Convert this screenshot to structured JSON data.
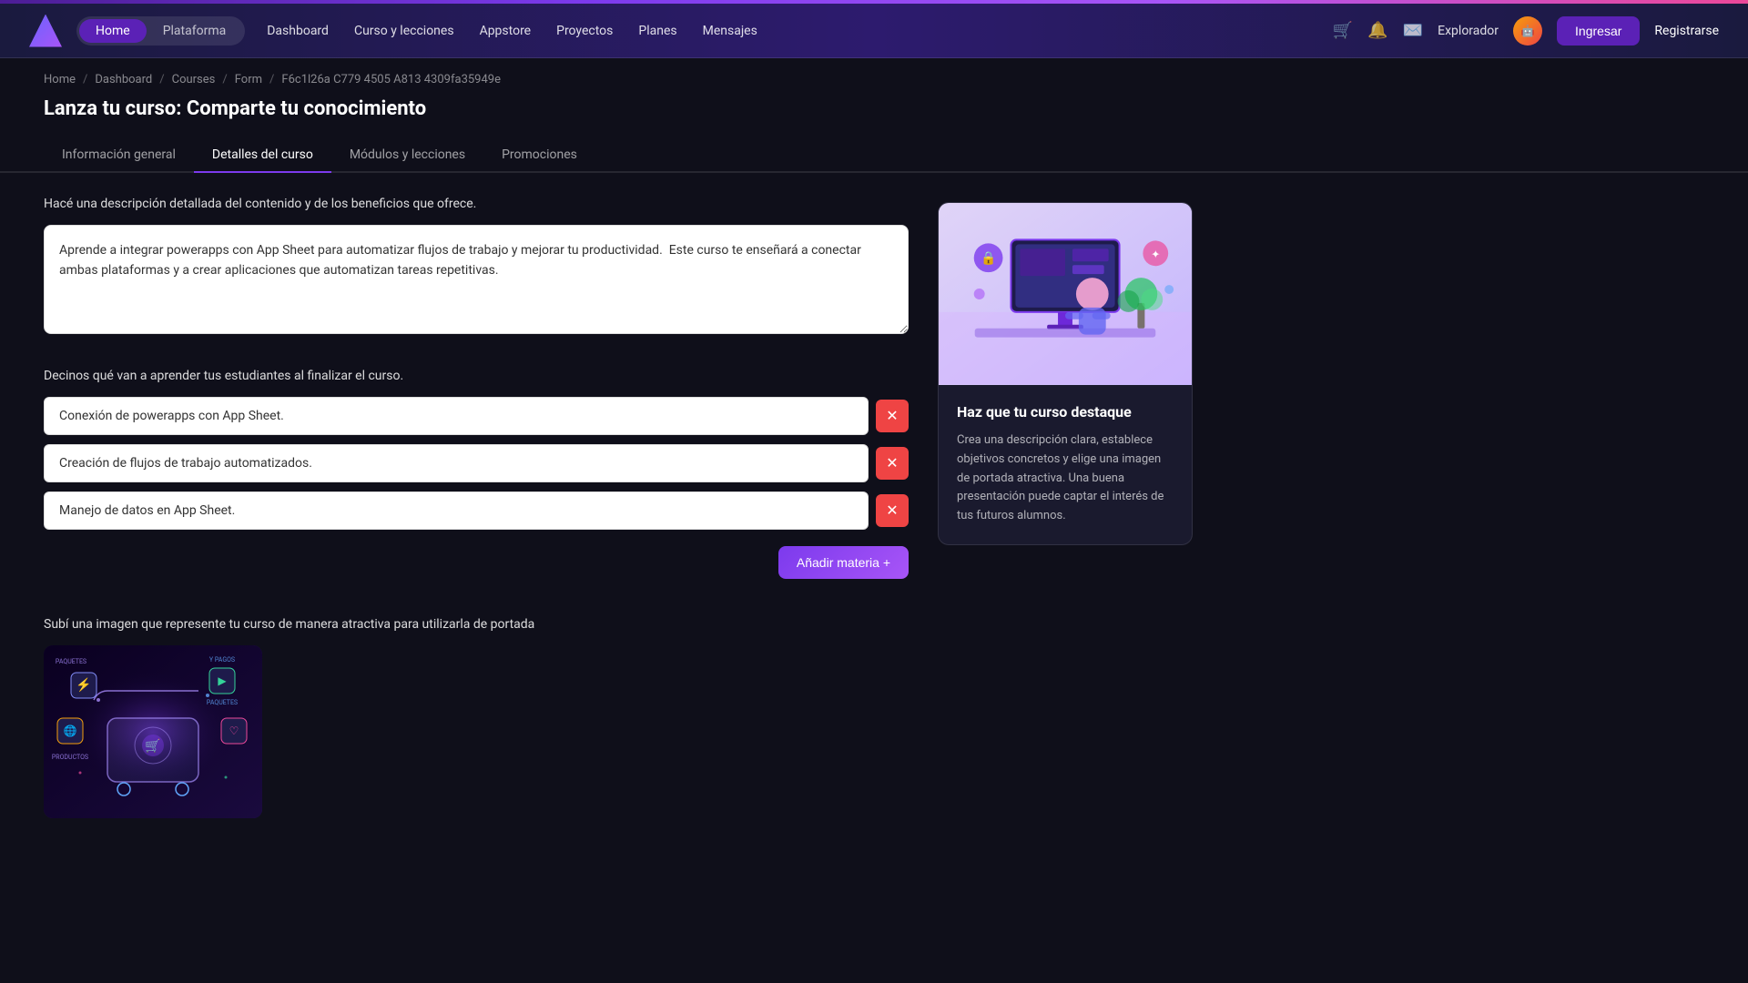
{
  "topbar": {
    "nav_pill_home": "Home",
    "nav_pill_plataforma": "Plataforma",
    "nav_dashboard": "Dashboard",
    "nav_curso": "Curso y lecciones",
    "nav_appstore": "Appstore",
    "nav_proyectos": "Proyectos",
    "nav_planes": "Planes",
    "nav_mensajes": "Mensajes",
    "nav_explorador": "Explorador",
    "btn_ingresar": "Ingresar",
    "btn_registrarse": "Registrarse"
  },
  "breadcrumb": {
    "home": "Home",
    "dashboard": "Dashboard",
    "courses": "Courses",
    "form": "Form",
    "id": "F6c1l26a C779 4505 A813 4309fa35949e"
  },
  "page": {
    "title": "Lanza tu curso: Comparte tu conocimiento"
  },
  "tabs": [
    {
      "label": "Información general",
      "active": false
    },
    {
      "label": "Detalles del curso",
      "active": true
    },
    {
      "label": "Módulos y lecciones",
      "active": false
    },
    {
      "label": "Promociones",
      "active": false
    }
  ],
  "description_section": {
    "label": "Hacé una descripción detallada del contenido y de los beneficios que ofrece.",
    "value": "Aprende a integrar powerapps con App Sheet para automatizar flujos de trabajo y mejorar tu productividad.  Este curso te enseñará a conectar ambas plataformas y a crear aplicaciones que automatizan tareas repetitivas."
  },
  "learning_section": {
    "label": "Decinos qué van a aprender tus estudiantes al finalizar el curso.",
    "items": [
      "Conexión de powerapps con App Sheet.",
      "Creación de flujos de trabajo automatizados.",
      "Manejo de datos en App Sheet."
    ],
    "add_btn": "Añadir materia  +"
  },
  "image_section": {
    "label": "Subí una imagen que represente tu curso de manera atractiva para utilizarla de portada"
  },
  "info_card": {
    "title": "Haz que tu curso destaque",
    "text": "Crea una descripción clara, establece objetivos concretos y elige una imagen de portada atractiva. Una buena presentación puede captar el interés de tus futuros alumnos."
  }
}
